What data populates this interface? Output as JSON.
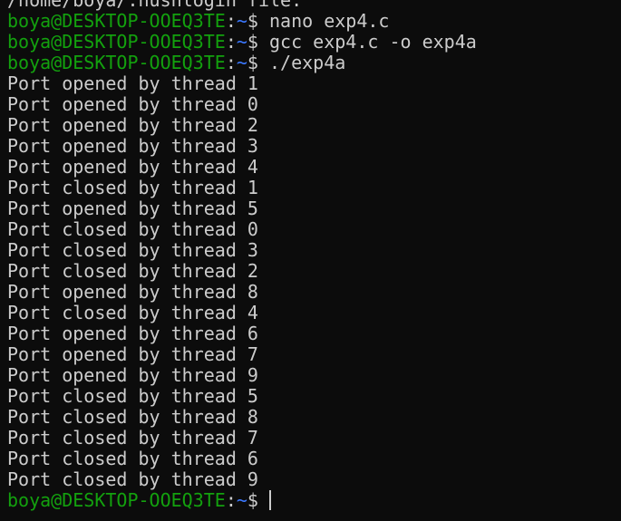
{
  "terminal": {
    "partial_top_line": "/home/boya/.hushlogin file.",
    "prompt": {
      "user_host": "boya@DESKTOP-OOEQ3TE",
      "separator": ":",
      "path": "~",
      "symbol": "$"
    },
    "commands": [
      "nano exp4.c",
      "gcc exp4.c -o exp4a",
      "./exp4a"
    ],
    "output": [
      "Port opened by thread 1",
      "Port opened by thread 0",
      "Port opened by thread 2",
      "Port opened by thread 3",
      "Port opened by thread 4",
      "Port closed by thread 1",
      "Port opened by thread 5",
      "Port closed by thread 0",
      "Port closed by thread 3",
      "Port closed by thread 2",
      "Port opened by thread 8",
      "Port closed by thread 4",
      "Port opened by thread 6",
      "Port opened by thread 7",
      "Port opened by thread 9",
      "Port closed by thread 5",
      "Port closed by thread 8",
      "Port closed by thread 7",
      "Port closed by thread 6",
      "Port closed by thread 9"
    ],
    "colors": {
      "background": "#0c0c0c",
      "text": "#cccccc",
      "user_host": "#13a10e",
      "path": "#3b78ff"
    }
  }
}
